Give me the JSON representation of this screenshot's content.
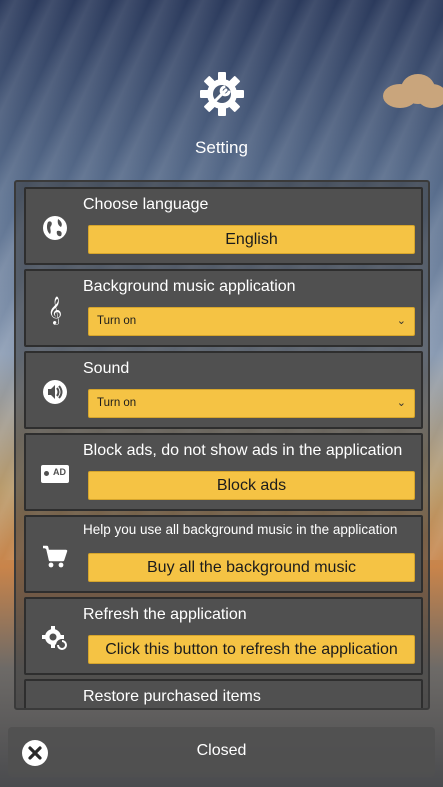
{
  "header": {
    "title": "Setting",
    "icon": "gear-wrench-icon"
  },
  "settings": {
    "language": {
      "label": "Choose language",
      "button_label": "English",
      "icon": "globe-icon"
    },
    "music": {
      "label": "Background music application",
      "selected": "Turn on",
      "icon": "treble-clef-icon"
    },
    "sound": {
      "label": "Sound",
      "selected": "Turn on",
      "icon": "speaker-icon"
    },
    "ads": {
      "label": "Block ads, do not show ads in the application",
      "button_label": "Block ads",
      "icon": "ad-block-icon",
      "icon_text": "AD"
    },
    "buy_music": {
      "label": "Help you use all background music in the application",
      "button_label": "Buy all the background music",
      "icon": "shopping-cart-icon"
    },
    "refresh": {
      "label": "Refresh the application",
      "button_label": "Click this button to refresh the application",
      "icon": "gear-refresh-icon"
    },
    "restore": {
      "label": "Restore purchased items",
      "icon": "restore-icon"
    }
  },
  "footer": {
    "close_label": "Closed",
    "close_icon": "close-icon"
  },
  "colors": {
    "button": "#f5c344",
    "item_bg": "#505050",
    "text": "#ffffff"
  }
}
